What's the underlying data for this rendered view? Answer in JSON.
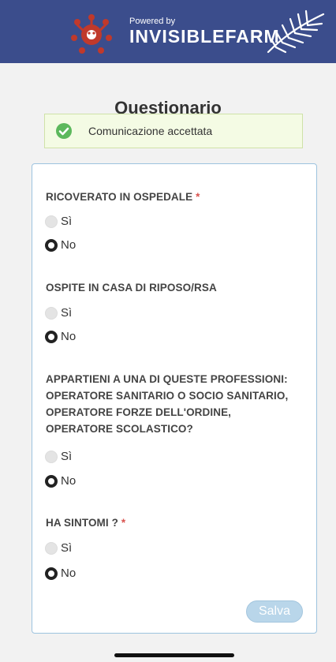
{
  "header": {
    "powered_by": "Powered by",
    "brand": "INVISIBLEFARM"
  },
  "page": {
    "title": "Questionario"
  },
  "alert": {
    "message": "Comunicazione accettata"
  },
  "questions": [
    {
      "label": "RICOVERATO IN OSPEDALE",
      "required": true,
      "options": [
        "Sì",
        "No"
      ],
      "selected": "No"
    },
    {
      "label": "OSPITE IN CASA DI RIPOSO/RSA",
      "required": false,
      "options": [
        "Sì",
        "No"
      ],
      "selected": "No"
    },
    {
      "label_lines": [
        "APPARTIENI A UNA DI QUESTE PROFESSIONI:",
        "OPERATORE SANITARIO O SOCIO SANITARIO,",
        "OPERATORE FORZE DELL'ORDINE,",
        "OPERATORE SCOLASTICO?"
      ],
      "required": false,
      "options": [
        "Sì",
        "No"
      ],
      "selected": "No"
    },
    {
      "label": "HA SINTOMI ?",
      "required": true,
      "options": [
        "Sì",
        "No"
      ],
      "selected": "No"
    }
  ],
  "required_marker": "*",
  "actions": {
    "save_label": "Salva"
  },
  "colors": {
    "header_bg": "#3b4d8c",
    "accent_red": "#d9534f",
    "success_green": "#5cb85c",
    "save_button": "#b9d6ea"
  }
}
